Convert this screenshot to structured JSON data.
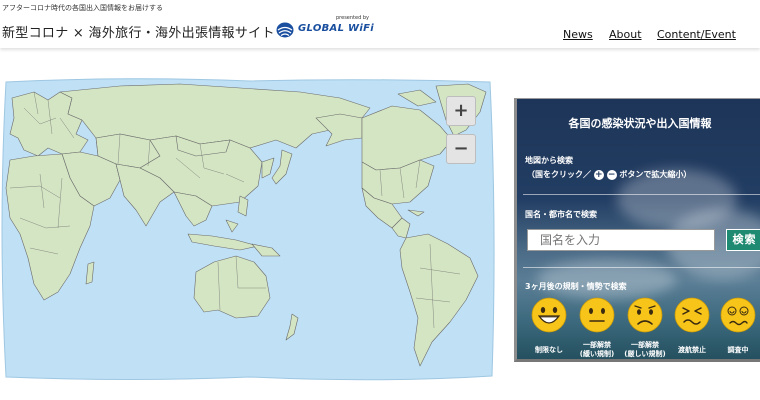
{
  "header": {
    "tagline": "アフターコロナ時代の各国出入国情報をお届けする",
    "title": "新型コロナ × 海外旅行・海外出張情報サイト",
    "logo_presented": "presented by",
    "logo_text": "GLOBAL WiFi",
    "nav": [
      "News",
      "About",
      "Content/Event"
    ]
  },
  "map": {
    "zoom_in": "+",
    "zoom_out": "−",
    "colors": {
      "ocean": "#bfe0f5",
      "land": "#d4e5c3",
      "border": "#6b6b6b"
    }
  },
  "panel": {
    "title": "各国の感染状況や出入国情報",
    "map_search_label": "地図から検索",
    "map_search_hint_prefix": "（国をクリック／",
    "map_search_hint_plus": "+",
    "map_search_hint_minus": "−",
    "map_search_hint_suffix": "ボタンで拡大縮小）",
    "name_search_label": "国名・都市名で検索",
    "search_placeholder": "国名を入力",
    "search_button": "検索",
    "outlook_label": "3ヶ月後の規制・情勢で検索",
    "faces": [
      {
        "icon": "grinning-face-icon",
        "label": "制限なし"
      },
      {
        "icon": "neutral-face-icon",
        "label": "一部解禁\n(緩い規制)"
      },
      {
        "icon": "worried-face-icon",
        "label": "一部解禁\n(厳しい規制)"
      },
      {
        "icon": "squinting-face-icon",
        "label": "渡航禁止"
      },
      {
        "icon": "dizzy-face-icon",
        "label": "調査中"
      }
    ],
    "face_color": "#f7c51a"
  }
}
